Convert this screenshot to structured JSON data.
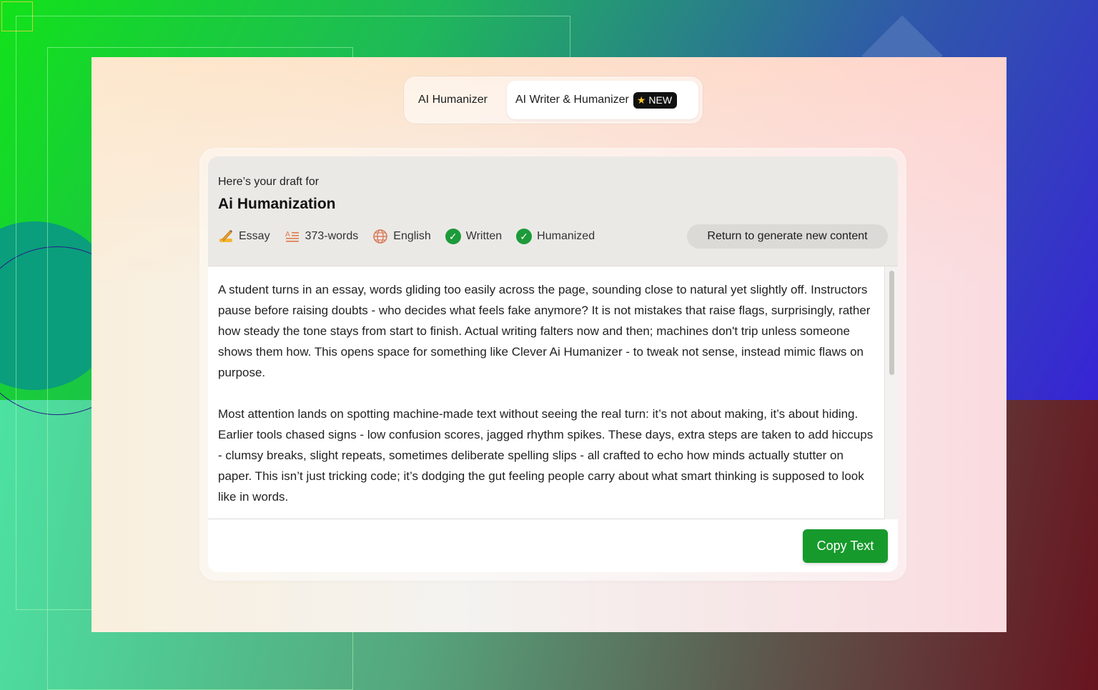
{
  "tabs": [
    {
      "label": "AI Humanizer",
      "active": false
    },
    {
      "label": "AI Writer & Humanizer",
      "active": true,
      "badge": "NEW"
    }
  ],
  "draft": {
    "intro": "Here’s your draft for",
    "title": "Ai Humanization"
  },
  "meta": {
    "type": {
      "icon": "writing-hand-icon",
      "label": "Essay"
    },
    "words": {
      "icon": "text-lines-icon",
      "label": "373-words"
    },
    "language": {
      "icon": "globe-icon",
      "label": "English"
    },
    "written": {
      "icon": "check-icon",
      "label": "Written"
    },
    "humanized": {
      "icon": "check-icon",
      "label": "Humanized"
    }
  },
  "actions": {
    "return_label": "Return to generate new content",
    "copy_label": "Copy Text"
  },
  "content": {
    "paragraphs": [
      "A student turns in an essay, words gliding too easily across the page, sounding close to natural yet slightly off. Instructors pause before raising doubts - who decides what feels fake anymore? It is not mistakes that raise flags, surprisingly, rather how steady the tone stays from start to finish. Actual writing falters now and then; machines don't trip unless someone shows them how. This opens space for something like Clever Ai Humanizer - to tweak not sense, instead mimic flaws on purpose.",
      "Most attention lands on spotting machine-made text without seeing the real turn: it’s not about making, it’s about hiding. Earlier tools chased signs - low confusion scores, jagged rhythm spikes. These days, extra steps are taken to add hiccups - clumsy breaks, slight repeats, sometimes deliberate spelling slips - all crafted to echo how minds actually stutter on paper. This isn’t just tricking code; it’s dodging the gut feeling people carry about what smart thinking is supposed to look like in words."
    ]
  },
  "colors": {
    "accent_green": "#179a2c",
    "check_green": "#1d9a3a",
    "badge_bg": "#111111",
    "star": "#f7c52b"
  }
}
